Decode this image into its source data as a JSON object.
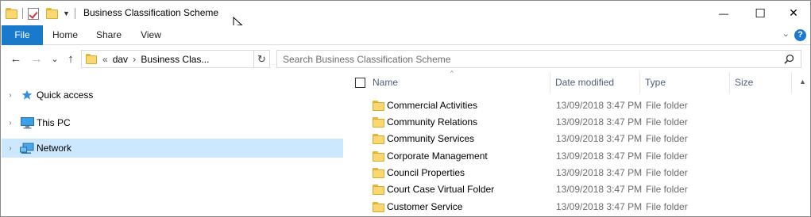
{
  "window": {
    "title": "Business Classification Scheme",
    "controls": {
      "minimize": "—",
      "maximize": "☐",
      "close": "✕"
    }
  },
  "ribbon": {
    "tabs": [
      {
        "label": "File"
      },
      {
        "label": "Home"
      },
      {
        "label": "Share"
      },
      {
        "label": "View"
      }
    ],
    "help_label": "?",
    "expand_chevron": "⌄"
  },
  "navigation": {
    "back": "←",
    "forward": "→",
    "recent": "⌄",
    "up": "↑"
  },
  "address_bar": {
    "overflow": "«",
    "crumbs": [
      "dav",
      "Business Clas..."
    ],
    "separator": "›",
    "refresh": "↻"
  },
  "search": {
    "placeholder": "Search Business Classification Scheme"
  },
  "nav_pane": {
    "items": [
      {
        "label": "Quick access",
        "icon": "star-icon",
        "expander": "›",
        "selected": false
      },
      {
        "label": "This PC",
        "icon": "computer-icon",
        "expander": "›",
        "selected": false
      },
      {
        "label": "Network",
        "icon": "network-icon",
        "expander": "›",
        "selected": true
      }
    ]
  },
  "file_list": {
    "sort_indicator": "^",
    "columns": {
      "name": "Name",
      "date_modified": "Date modified",
      "type": "Type",
      "size": "Size"
    },
    "rows": [
      {
        "name": "Commercial Activities",
        "date": "13/09/2018 3:47 PM",
        "type": "File folder"
      },
      {
        "name": "Community Relations",
        "date": "13/09/2018 3:47 PM",
        "type": "File folder"
      },
      {
        "name": "Community Services",
        "date": "13/09/2018 3:47 PM",
        "type": "File folder"
      },
      {
        "name": "Corporate Management",
        "date": "13/09/2018 3:47 PM",
        "type": "File folder"
      },
      {
        "name": "Council Properties",
        "date": "13/09/2018 3:47 PM",
        "type": "File folder"
      },
      {
        "name": "Court Case Virtual Folder",
        "date": "13/09/2018 3:47 PM",
        "type": "File folder"
      },
      {
        "name": "Customer Service",
        "date": "13/09/2018 3:47 PM",
        "type": "File folder"
      }
    ]
  },
  "scrollbar": {
    "up_arrow": "▲"
  },
  "colors": {
    "accent": "#1979ca",
    "selection": "#cce8ff",
    "folder": "#f8d775",
    "header_text": "#4c607a",
    "secondary_text": "#6d6d6d"
  }
}
